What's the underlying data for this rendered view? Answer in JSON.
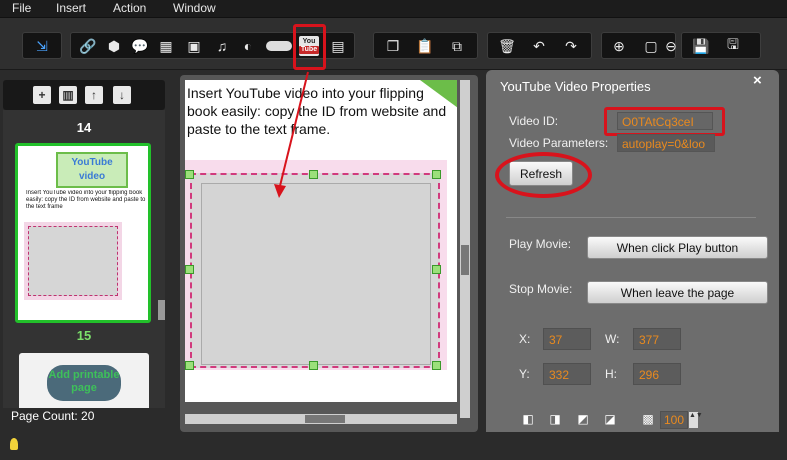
{
  "menu": [
    "File",
    "Insert",
    "Action",
    "Window"
  ],
  "toolbar": {
    "pointer_icon": "pointer-icon",
    "youtube_top": "You",
    "youtube_bottom": "Tube"
  },
  "left_panel": {
    "page_top_label": "14",
    "page_current_label": "15",
    "thumb_title": "YouTube video",
    "thumb_text": "Insert YouTube video into your flipping book easily: copy the ID from website and paste to the text frame",
    "thumb2_text": "Add printable page",
    "page_count": "Page Count: 20"
  },
  "canvas": {
    "page_text": "Insert YouTube video into your flipping book easily: copy the ID from website and paste to the text frame."
  },
  "properties": {
    "title": "YouTube Video Properties",
    "close": "×",
    "video_id_label": "Video ID:",
    "video_id_value": "O0TAtCq3ceI",
    "video_params_label": "Video Parameters:",
    "video_params_value": "autoplay=0&loo",
    "refresh": "Refresh",
    "play_movie_label": "Play Movie:",
    "play_movie_value": "When click Play button",
    "stop_movie_label": "Stop Movie:",
    "stop_movie_value": "When leave the page",
    "x_label": "X:",
    "x_value": "37",
    "w_label": "W:",
    "w_value": "377",
    "y_label": "Y:",
    "y_value": "332",
    "h_label": "H:",
    "h_value": "296",
    "opacity_value": "100"
  },
  "colors": {
    "accent": "#e98a1f",
    "annotation": "#d8131c",
    "selection": "#22c02a"
  }
}
